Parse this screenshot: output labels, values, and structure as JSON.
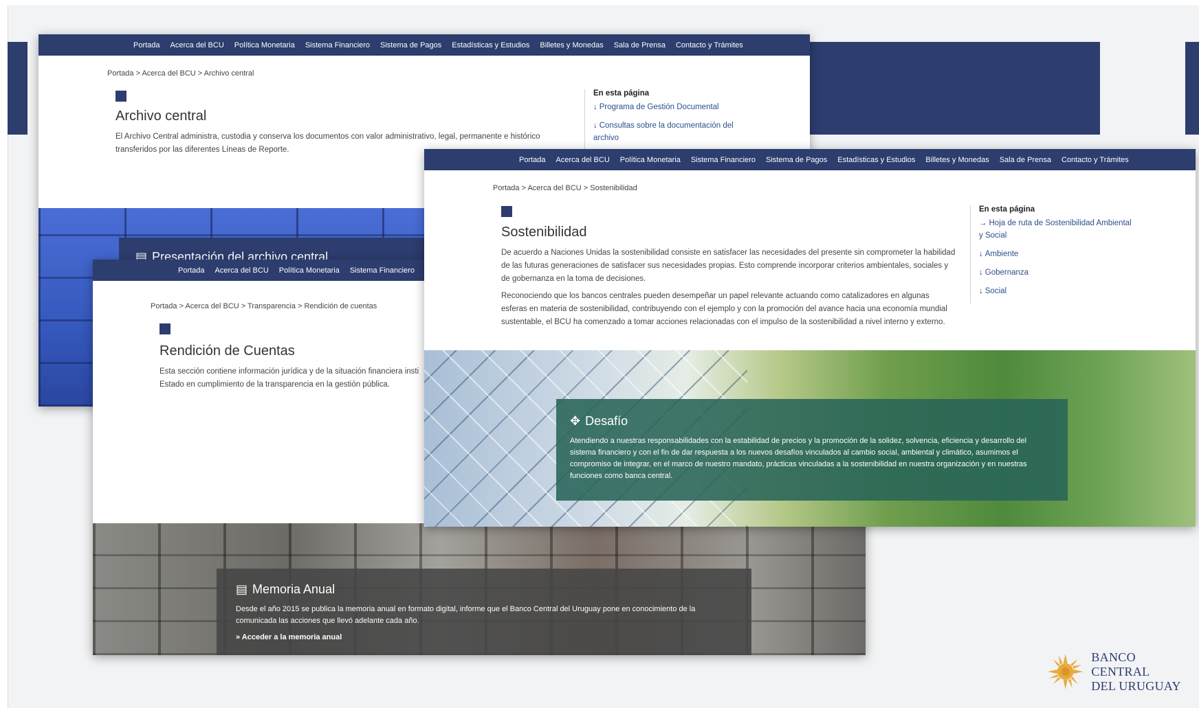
{
  "nav": {
    "items": [
      "Portada",
      "Acerca del BCU",
      "Política Monetaria",
      "Sistema Financiero",
      "Sistema de Pagos",
      "Estadísticas y Estudios",
      "Billetes y Monedas",
      "Sala de Prensa",
      "Contacto y Trámites"
    ]
  },
  "archivo": {
    "breadcrumb": "Portada > Acerca del BCU > Archivo central",
    "title": "Archivo central",
    "body": "El Archivo Central administra, custodia y conserva los documentos con valor administrativo, legal, permanente e histórico transferidos por las diferentes Líneas de Reporte.",
    "toc_title": "En esta página",
    "toc": [
      "Programa de Gestión Documental",
      "Consultas sobre la documentación del archivo"
    ],
    "card_title": "Presentación del archivo central"
  },
  "rendicion": {
    "breadcrumb": "Portada > Acerca del BCU > Transparencia > Rendición de cuentas",
    "title": "Rendición de Cuentas",
    "body": "Esta sección contiene información jurídica y de la situación financiera insti Estado en cumplimiento de la transparencia en la gestión pública.",
    "card_title": "Memoria Anual",
    "card_body": "Desde el año 2015 se publica la memoria anual en formato digital, informe que el Banco Central del Uruguay pone en conocimiento de la comunicada las acciones que llevó adelante cada año.",
    "card_link": "» Acceder a la memoria anual"
  },
  "sostenibilidad": {
    "breadcrumb": "Portada > Acerca del BCU > Sostenibilidad",
    "title": "Sostenibilidad",
    "p1": "De acuerdo a Naciones Unidas la sostenibilidad consiste en satisfacer las necesidades del presente sin comprometer la habilidad de las futuras generaciones de satisfacer sus necesidades propias. Esto comprende incorporar criterios ambientales, sociales y de gobernanza en la toma de decisiones.",
    "p2": "Reconociendo que los bancos centrales pueden desempeñar un papel relevante actuando como catalizadores en algunas esferas en materia de sostenibilidad, contribuyendo con el ejemplo y con la promoción del avance hacia una economía mundial sustentable, el BCU ha comenzado a tomar acciones relacionadas con el impulso de la sostenibilidad a nivel interno y externo.",
    "toc_title": "En esta página",
    "toc": [
      "Hoja de ruta de Sostenibilidad Ambiental y Social",
      "Ambiente",
      "Gobernanza",
      "Social"
    ],
    "card_title": "Desafío",
    "card_body": "Atendiendo a nuestras responsabilidades con la estabilidad de precios y la promoción de la solidez, solvencia, eficiencia y desarrollo del sistema financiero y con el fin de dar respuesta a los nuevos desafíos vinculados al cambio social, ambiental y climático, asumimos el compromiso de integrar, en el marco de nuestro mandato, prácticas vinculadas a la sostenibilidad en nuestra organización y en nuestras funciones como banca central."
  },
  "logo": {
    "line1": "BANCO CENTRAL",
    "line2": "DEL URUGUAY"
  },
  "colors": {
    "navy": "#2c3d6e",
    "link": "#2c4f8a",
    "card_green": "#2f6e62",
    "card_gray": "#5a5a5a",
    "sun": "#e8a93a"
  }
}
